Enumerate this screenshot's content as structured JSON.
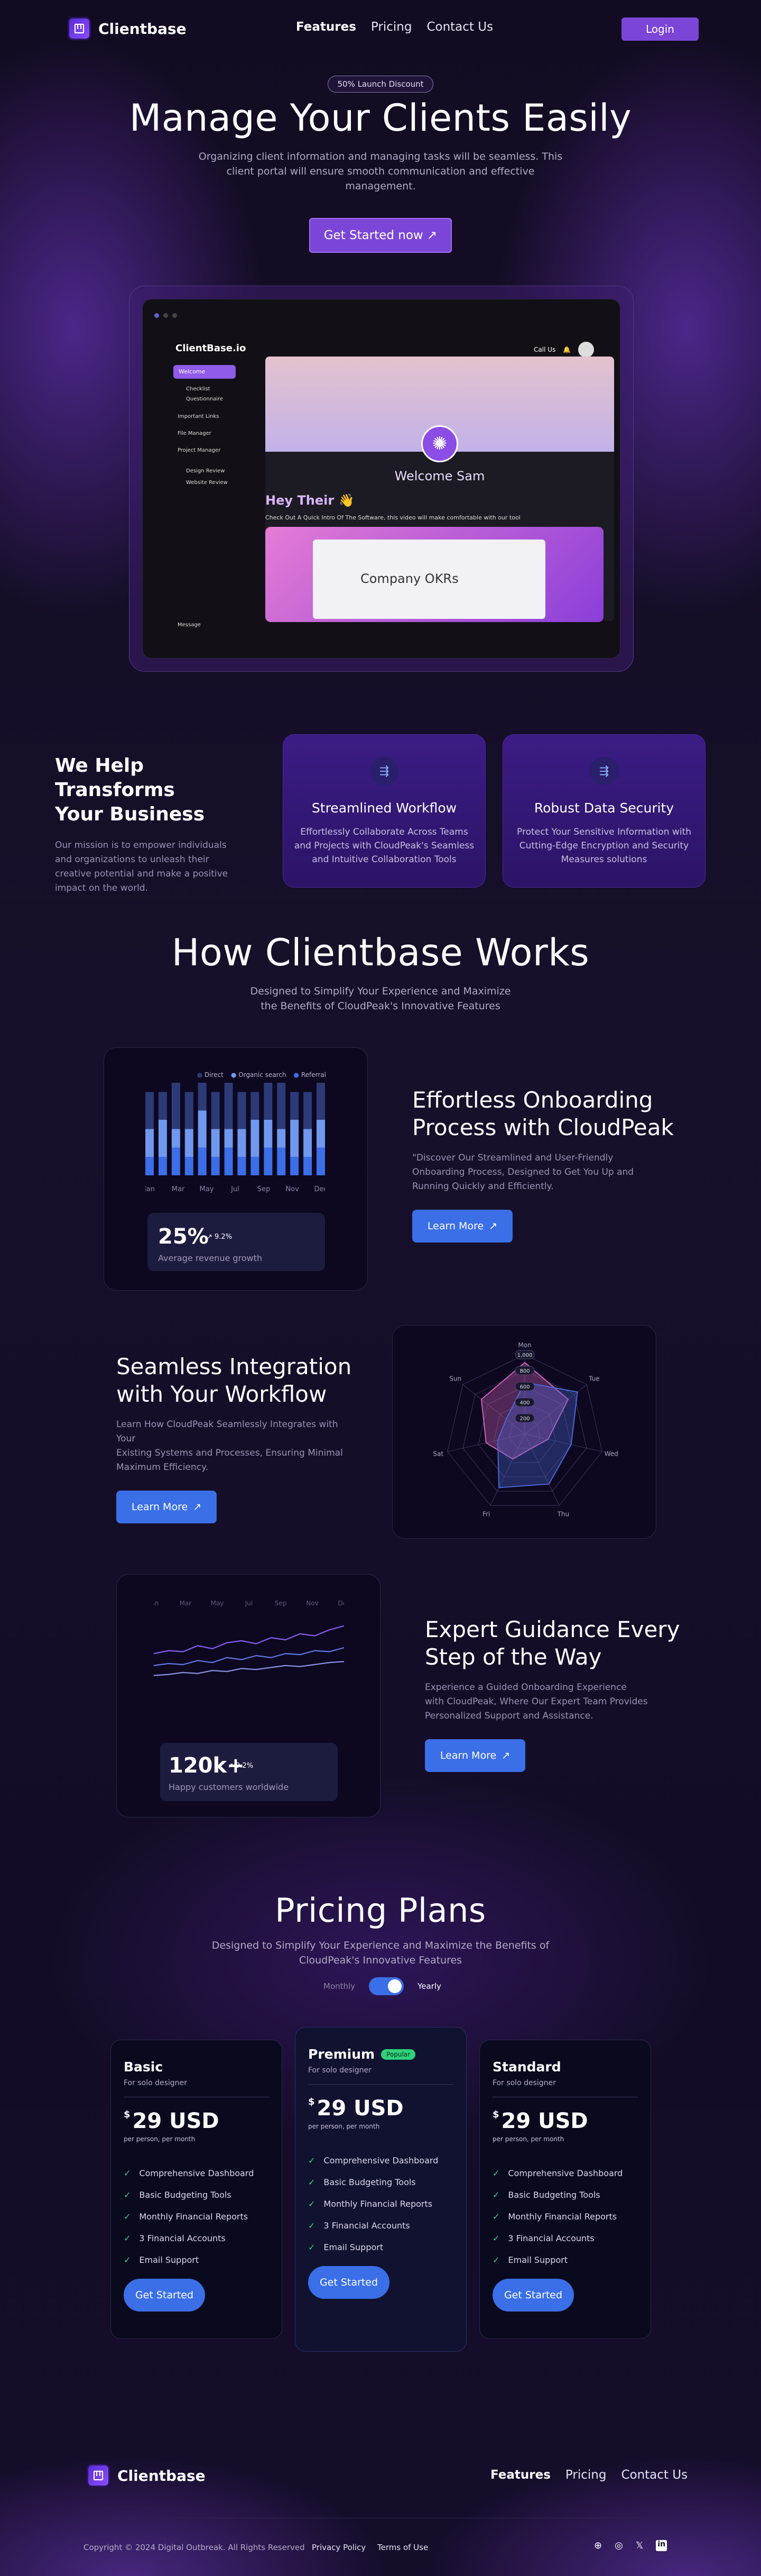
{
  "brand": {
    "name": "Clientbase"
  },
  "nav": {
    "items": [
      "Features",
      "Pricing",
      "Contact Us"
    ],
    "login": "Login"
  },
  "hero": {
    "badge": "50% Launch Discount",
    "title": "Manage Your Clients Easily",
    "subtitle_lines": [
      "Organizing client information and managing tasks will be seamless. This",
      "client portal will ensure smooth communication and effective",
      "management."
    ],
    "cta": "Get Started now ↗"
  },
  "app": {
    "brand": "ClientBase.io",
    "header_links": [
      "Call Us"
    ],
    "sidebar": [
      "Welcome",
      "Checklist",
      "Questionnaire",
      "Important Links",
      "File Manager",
      "Project Manager",
      "Design Review",
      "Website Review",
      "Message"
    ],
    "welcome": "Welcome Sam",
    "greeting": "Hey Their 👋",
    "intro": "Check Out A Quick Intro Of The Software, this video will make comfortable with our tool",
    "video_title": "Company OKRs"
  },
  "help": {
    "title_lines": [
      "We Help Transforms",
      "Your Business"
    ],
    "text_lines": [
      "Our mission is to empower individuals",
      "and organizations to unleash their",
      "creative potential and make a positive",
      "impact on the world."
    ],
    "features": [
      {
        "title": "Streamlined Workflow",
        "lines": [
          "Effortlessly Collaborate Across Teams",
          "and Projects with CloudPeak's Seamless",
          "and Intuitive Collaboration Tools"
        ]
      },
      {
        "title": "Robust Data Security",
        "lines": [
          "Protect Your Sensitive Information with",
          "Cutting-Edge Encryption and Security",
          "Measures solutions"
        ]
      }
    ]
  },
  "how": {
    "title": "How Clientbase Works",
    "subtitle_lines": [
      "Designed to Simplify Your Experience and Maximize",
      "the Benefits of CloudPeak's Innovative Features"
    ]
  },
  "step1": {
    "title_lines": [
      "Effortless Onboarding",
      "Process with CloudPeak"
    ],
    "text_lines": [
      "\"Discover Our Streamlined and User-Friendly",
      "Onboarding Process, Designed to Get You Up and",
      "Running Quickly and Efficiently."
    ],
    "cta": "Learn More",
    "stat": "25%",
    "change": "↗ 9.2%",
    "stat_label": "Average revenue growth"
  },
  "step2": {
    "title_lines": [
      "Seamless Integration",
      "with Your Workflow"
    ],
    "text_lines": [
      "Learn How CloudPeak Seamlessly Integrates with Your",
      "Existing Systems and Processes, Ensuring Minimal",
      "Maximum Efficiency."
    ],
    "cta": "Learn More"
  },
  "step3": {
    "title_lines": [
      "Expert Guidance Every",
      "Step of the Way"
    ],
    "text_lines": [
      "Experience a Guided Onboarding Experience",
      "with CloudPeak, Where Our Expert Team Provides",
      "Personalized Support and Assistance."
    ],
    "cta": "Learn More",
    "stat": "120k+",
    "change": "↗ 9.2%",
    "stat_label": "Happy customers worldwide"
  },
  "pricing": {
    "title": "Pricing Plans",
    "subtitle_lines": [
      "Designed to Simplify Your Experience and Maximize the Benefits of",
      "CloudPeak's Innovative Features"
    ],
    "monthly": "Monthly",
    "yearly": "Yearly",
    "plans": [
      {
        "name": "Basic",
        "for": "For solo designer",
        "price": "29 USD",
        "per": "per person, per month",
        "cta": "Get Started",
        "badge": ""
      },
      {
        "name": "Premium",
        "for": "For solo designer",
        "price": "29 USD",
        "per": "per person, per month",
        "cta": "Get Started",
        "badge": "Popular"
      },
      {
        "name": "Standard",
        "for": "For solo designer",
        "price": "29 USD",
        "per": "per person, per month",
        "cta": "Get Started",
        "badge": ""
      }
    ],
    "features": [
      "Comprehensive Dashboard",
      "Basic Budgeting Tools",
      "Monthly Financial Reports",
      "3 Financial Accounts",
      "Email Support"
    ]
  },
  "footer": {
    "copyright": "Copyright © 2024 Digital Outbreak. All Rights Reserved",
    "privacy": "Privacy Policy",
    "terms": "Terms of Use"
  },
  "chart_data": [
    {
      "type": "bar",
      "legend": [
        "Direct",
        "Organic search",
        "Referral"
      ],
      "legend_position": "top-right",
      "categories": [
        "Jan",
        "Mar",
        "May",
        "Jul",
        "Sep",
        "Nov",
        "Dec"
      ],
      "grid": false,
      "series": [
        {
          "name": "Direct",
          "values": [
            4,
            3,
            5,
            4,
            3,
            4,
            5,
            4,
            3,
            4,
            5,
            3,
            4,
            4
          ]
        },
        {
          "name": "Organic search",
          "values": [
            3,
            4,
            2,
            3,
            4,
            3,
            2,
            3,
            4,
            3,
            2,
            4,
            3,
            3
          ]
        },
        {
          "name": "Referral",
          "values": [
            2,
            2,
            3,
            2,
            3,
            2,
            3,
            2,
            2,
            3,
            3,
            2,
            2,
            3
          ]
        }
      ],
      "colors": [
        "#2c3a78",
        "#6f98ee",
        "#3b6ee8"
      ]
    },
    {
      "type": "radar",
      "axes": [
        "Mon",
        "Tue",
        "Wed",
        "Thu",
        "Fri",
        "Sat",
        "Sun"
      ],
      "ticks": [
        "1,000",
        "800",
        "600",
        "400",
        "200"
      ],
      "max": 1000,
      "grid": true,
      "series": [
        {
          "values": [
            900,
            700,
            300,
            200,
            350,
            500,
            700
          ],
          "color": "#d061b9"
        },
        {
          "values": [
            650,
            850,
            600,
            700,
            750,
            350,
            300
          ],
          "color": "#4b66d8"
        }
      ]
    },
    {
      "type": "line",
      "categories": [
        "Jan",
        "Mar",
        "May",
        "Jul",
        "Sep",
        "Nov",
        "Dec"
      ],
      "grid": false,
      "series": [
        {
          "values": [
            42,
            45,
            44,
            50,
            47,
            53,
            55,
            52,
            58,
            56,
            62,
            60,
            66,
            70
          ],
          "color": "#8a5df0"
        },
        {
          "values": [
            30,
            32,
            31,
            35,
            33,
            38,
            36,
            40,
            38,
            42,
            41,
            45,
            44,
            48
          ],
          "color": "#6178e8"
        },
        {
          "values": [
            20,
            21,
            23,
            22,
            25,
            24,
            27,
            26,
            28,
            30,
            29,
            31,
            33,
            34
          ],
          "color": "#8a8fe0"
        }
      ]
    }
  ]
}
